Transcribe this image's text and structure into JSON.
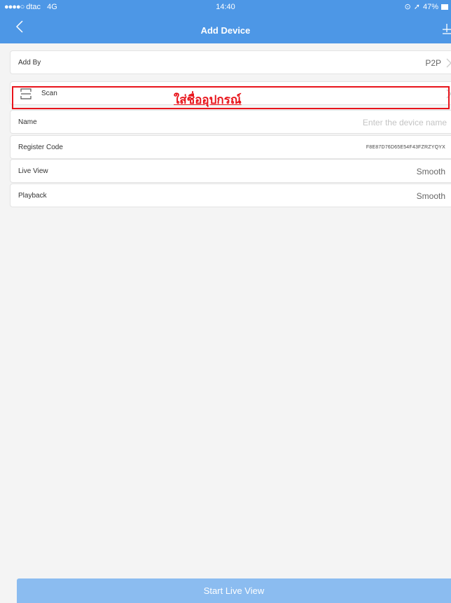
{
  "status_bar": {
    "carrier": "dtac",
    "network": "4G",
    "time": "14:40",
    "battery": "47%"
  },
  "nav": {
    "title": "Add Device"
  },
  "rows": {
    "add_by": {
      "label": "Add By",
      "value": "P2P"
    },
    "scan": {
      "label": "Scan"
    },
    "name": {
      "label": "Name",
      "value": "",
      "placeholder": "Enter the device name"
    },
    "register_code": {
      "label": "Register Code",
      "value": "F8E87D76D65E54F43FZRZYQYX"
    },
    "live_view": {
      "label": "Live View",
      "value": "Smooth"
    },
    "playback": {
      "label": "Playback",
      "value": "Smooth"
    }
  },
  "annotation": {
    "text": "ใส่ชื่ออุปกรณ์",
    "color": "#e8141b"
  },
  "buttons": {
    "start_live_view": "Start Live View"
  },
  "colors": {
    "nav_bar": "#4d97e6",
    "start_button": "#8bbcf0",
    "background": "#f4f4f4"
  },
  "icons": {
    "back": "chevron-left-icon",
    "right": "device-list-icon",
    "scan": "qr-scan-icon",
    "chevron": "chevron-right-icon"
  }
}
